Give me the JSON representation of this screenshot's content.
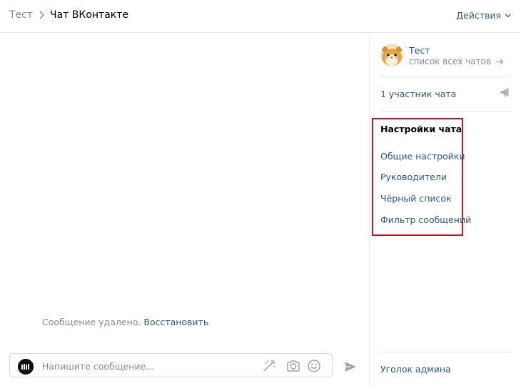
{
  "header": {
    "breadcrumb_root": "Тест",
    "title": "Чат ВКонтакте",
    "actions_label": "Действия"
  },
  "chat": {
    "deleted_notice": "Сообщение удалено.",
    "restore_link": "Восстановить"
  },
  "composer": {
    "placeholder": "Напишите сообщение...",
    "icons": [
      "avatar",
      "sparkler-icon",
      "camera-icon",
      "smile-icon",
      "send-icon"
    ]
  },
  "sidebar": {
    "peer_name": "Тест",
    "peer_subtitle": "список всех чатов",
    "members": "1 участник чата",
    "settings": {
      "title": "Настройки чата",
      "links": [
        "Общие настройки",
        "Руководители",
        "Чёрный список",
        "Фильтр сообщений"
      ]
    },
    "admin_corner": "Уголок админа"
  },
  "colors": {
    "link": "#2a5885",
    "muted": "#818c99",
    "border": "#e7e8ec",
    "highlight": "#d3101e"
  }
}
